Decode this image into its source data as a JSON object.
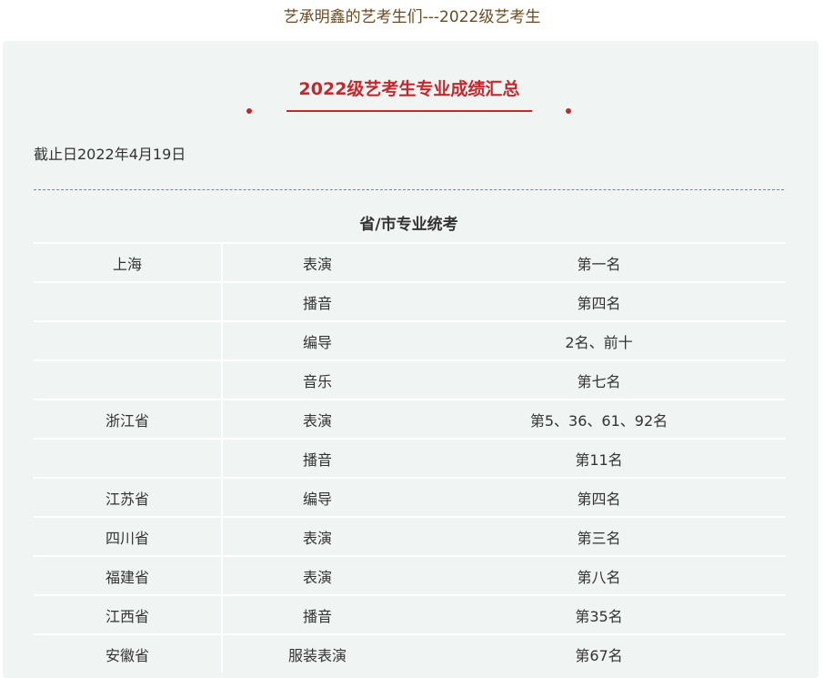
{
  "page": {
    "top_title": "艺承明鑫的艺考生们---2022级艺考生"
  },
  "article": {
    "heading": "2022级艺考生专业成绩汇总",
    "cutoff_date": "截止日2022年4月19日",
    "section_title": "省/市专业统考"
  },
  "table": {
    "rows": [
      {
        "region": "上海",
        "major": "表演",
        "result": "第一名"
      },
      {
        "region": "",
        "major": "播音",
        "result": "第四名"
      },
      {
        "region": "",
        "major": "编导",
        "result": "2名、前十"
      },
      {
        "region": "",
        "major": "音乐",
        "result": "第七名"
      },
      {
        "region": "浙江省",
        "major": "表演",
        "result": "第5、36、61、92名"
      },
      {
        "region": "",
        "major": "播音",
        "result": "第11名"
      },
      {
        "region": "江苏省",
        "major": "编导",
        "result": "第四名"
      },
      {
        "region": "四川省",
        "major": "表演",
        "result": "第三名"
      },
      {
        "region": "福建省",
        "major": "表演",
        "result": "第八名"
      },
      {
        "region": "江西省",
        "major": "播音",
        "result": "第35名"
      },
      {
        "region": "安徽省",
        "major": "服装表演",
        "result": "第67名"
      }
    ]
  },
  "colors": {
    "accent_red": "#c2292e",
    "title_brown": "#6b4a1f",
    "panel_bg": "#f0f4f3"
  }
}
